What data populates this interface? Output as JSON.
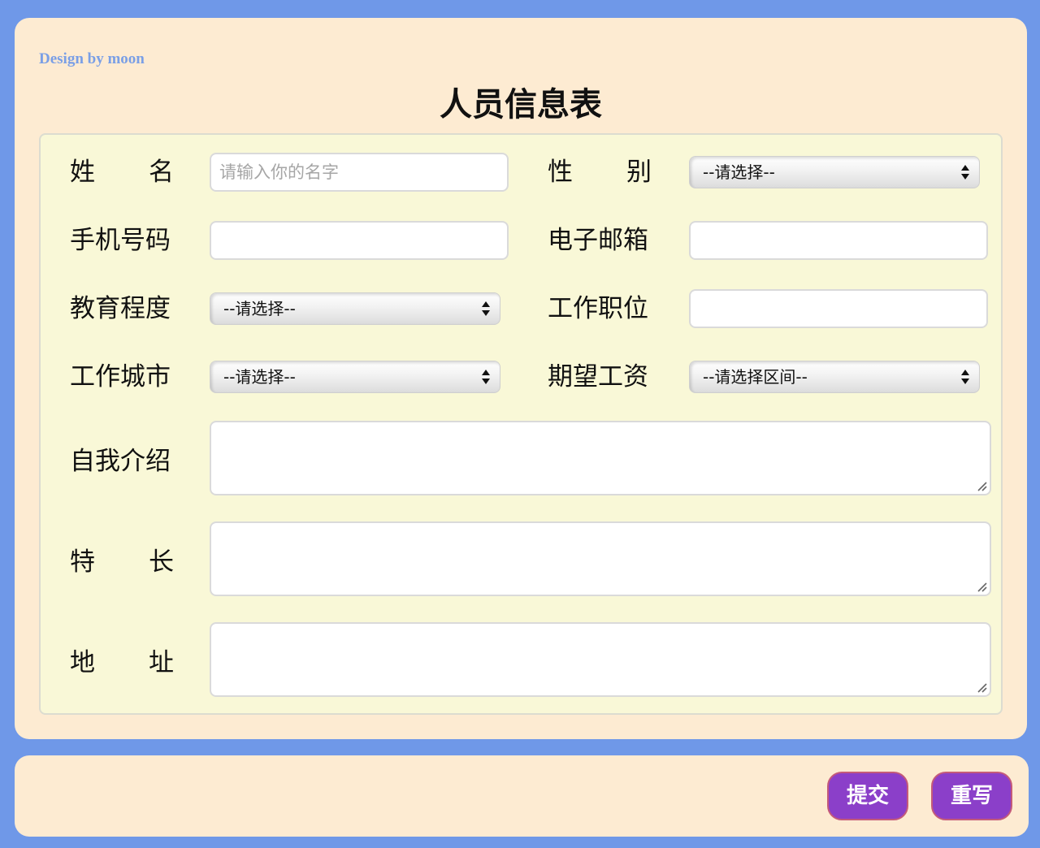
{
  "header": {
    "designer_credit": "Design by moon",
    "title": "人员信息表"
  },
  "form": {
    "name": {
      "label_chars": [
        "姓",
        "名"
      ],
      "placeholder": "请输入你的名字"
    },
    "gender": {
      "label_chars": [
        "性",
        "别"
      ],
      "selected": "--请选择--"
    },
    "phone": {
      "label": "手机号码",
      "value": ""
    },
    "email": {
      "label": "电子邮箱",
      "value": ""
    },
    "education": {
      "label": "教育程度",
      "selected": "--请选择--"
    },
    "position": {
      "label": "工作职位",
      "value": ""
    },
    "city": {
      "label": "工作城市",
      "selected": "--请选择--"
    },
    "salary": {
      "label": "期望工资",
      "selected": "--请选择区间--"
    },
    "intro": {
      "label": "自我介绍",
      "value": ""
    },
    "skills": {
      "label_chars": [
        "特",
        "长"
      ],
      "value": ""
    },
    "address": {
      "label_chars": [
        "地",
        "址"
      ],
      "value": ""
    }
  },
  "footer": {
    "submit_label": "提交",
    "reset_label": "重写"
  },
  "colors": {
    "background": "#6f98e8",
    "card": "#fdebd2",
    "panel": "#f9f8d7",
    "button": "#8b3fc9",
    "credit": "#7a9fe6"
  }
}
